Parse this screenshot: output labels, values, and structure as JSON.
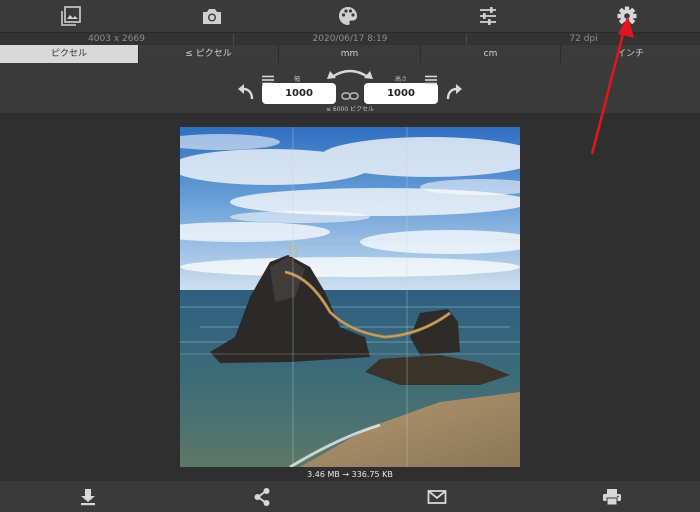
{
  "toolbar": {
    "icons": [
      "gallery-icon",
      "camera-icon",
      "palette-icon",
      "sliders-icon",
      "gear-icon"
    ]
  },
  "info": {
    "dimensions": "4003 x 2669",
    "datetime": "2020/06/17 8:19",
    "dpi": "72 dpi"
  },
  "units": {
    "options": [
      "ピクセル",
      "≤ ピクセル",
      "mm",
      "cm",
      "インチ"
    ],
    "selected": "ピクセル"
  },
  "resize": {
    "width_label": "幅",
    "width_value": "1000",
    "height_label": "高さ",
    "height_value": "1000",
    "max_note": "≤ 6000 ピクセル"
  },
  "file_size": {
    "text": "3.46 MB → 336.75 KB"
  },
  "bottom": {
    "icons": [
      "download-icon",
      "share-icon",
      "mail-icon",
      "print-icon"
    ]
  },
  "colors": {
    "annotation_red": "#e2141f",
    "active_unit_bg": "#d9d9d9"
  }
}
